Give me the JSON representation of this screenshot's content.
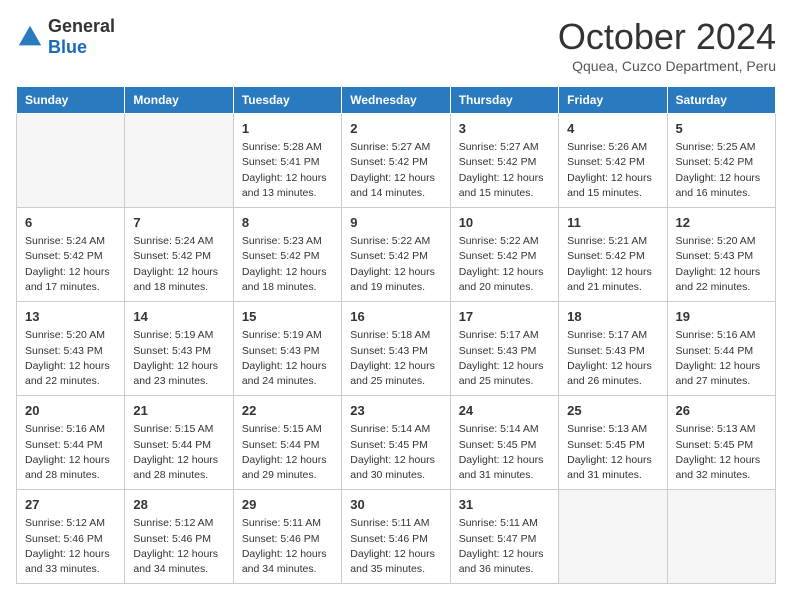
{
  "logo": {
    "general": "General",
    "blue": "Blue"
  },
  "title": "October 2024",
  "subtitle": "Qquea, Cuzco Department, Peru",
  "days_of_week": [
    "Sunday",
    "Monday",
    "Tuesday",
    "Wednesday",
    "Thursday",
    "Friday",
    "Saturday"
  ],
  "weeks": [
    [
      {
        "day": "",
        "sunrise": "",
        "sunset": "",
        "daylight": ""
      },
      {
        "day": "",
        "sunrise": "",
        "sunset": "",
        "daylight": ""
      },
      {
        "day": "1",
        "sunrise": "Sunrise: 5:28 AM",
        "sunset": "Sunset: 5:41 PM",
        "daylight": "Daylight: 12 hours and 13 minutes."
      },
      {
        "day": "2",
        "sunrise": "Sunrise: 5:27 AM",
        "sunset": "Sunset: 5:42 PM",
        "daylight": "Daylight: 12 hours and 14 minutes."
      },
      {
        "day": "3",
        "sunrise": "Sunrise: 5:27 AM",
        "sunset": "Sunset: 5:42 PM",
        "daylight": "Daylight: 12 hours and 15 minutes."
      },
      {
        "day": "4",
        "sunrise": "Sunrise: 5:26 AM",
        "sunset": "Sunset: 5:42 PM",
        "daylight": "Daylight: 12 hours and 15 minutes."
      },
      {
        "day": "5",
        "sunrise": "Sunrise: 5:25 AM",
        "sunset": "Sunset: 5:42 PM",
        "daylight": "Daylight: 12 hours and 16 minutes."
      }
    ],
    [
      {
        "day": "6",
        "sunrise": "Sunrise: 5:24 AM",
        "sunset": "Sunset: 5:42 PM",
        "daylight": "Daylight: 12 hours and 17 minutes."
      },
      {
        "day": "7",
        "sunrise": "Sunrise: 5:24 AM",
        "sunset": "Sunset: 5:42 PM",
        "daylight": "Daylight: 12 hours and 18 minutes."
      },
      {
        "day": "8",
        "sunrise": "Sunrise: 5:23 AM",
        "sunset": "Sunset: 5:42 PM",
        "daylight": "Daylight: 12 hours and 18 minutes."
      },
      {
        "day": "9",
        "sunrise": "Sunrise: 5:22 AM",
        "sunset": "Sunset: 5:42 PM",
        "daylight": "Daylight: 12 hours and 19 minutes."
      },
      {
        "day": "10",
        "sunrise": "Sunrise: 5:22 AM",
        "sunset": "Sunset: 5:42 PM",
        "daylight": "Daylight: 12 hours and 20 minutes."
      },
      {
        "day": "11",
        "sunrise": "Sunrise: 5:21 AM",
        "sunset": "Sunset: 5:42 PM",
        "daylight": "Daylight: 12 hours and 21 minutes."
      },
      {
        "day": "12",
        "sunrise": "Sunrise: 5:20 AM",
        "sunset": "Sunset: 5:43 PM",
        "daylight": "Daylight: 12 hours and 22 minutes."
      }
    ],
    [
      {
        "day": "13",
        "sunrise": "Sunrise: 5:20 AM",
        "sunset": "Sunset: 5:43 PM",
        "daylight": "Daylight: 12 hours and 22 minutes."
      },
      {
        "day": "14",
        "sunrise": "Sunrise: 5:19 AM",
        "sunset": "Sunset: 5:43 PM",
        "daylight": "Daylight: 12 hours and 23 minutes."
      },
      {
        "day": "15",
        "sunrise": "Sunrise: 5:19 AM",
        "sunset": "Sunset: 5:43 PM",
        "daylight": "Daylight: 12 hours and 24 minutes."
      },
      {
        "day": "16",
        "sunrise": "Sunrise: 5:18 AM",
        "sunset": "Sunset: 5:43 PM",
        "daylight": "Daylight: 12 hours and 25 minutes."
      },
      {
        "day": "17",
        "sunrise": "Sunrise: 5:17 AM",
        "sunset": "Sunset: 5:43 PM",
        "daylight": "Daylight: 12 hours and 25 minutes."
      },
      {
        "day": "18",
        "sunrise": "Sunrise: 5:17 AM",
        "sunset": "Sunset: 5:43 PM",
        "daylight": "Daylight: 12 hours and 26 minutes."
      },
      {
        "day": "19",
        "sunrise": "Sunrise: 5:16 AM",
        "sunset": "Sunset: 5:44 PM",
        "daylight": "Daylight: 12 hours and 27 minutes."
      }
    ],
    [
      {
        "day": "20",
        "sunrise": "Sunrise: 5:16 AM",
        "sunset": "Sunset: 5:44 PM",
        "daylight": "Daylight: 12 hours and 28 minutes."
      },
      {
        "day": "21",
        "sunrise": "Sunrise: 5:15 AM",
        "sunset": "Sunset: 5:44 PM",
        "daylight": "Daylight: 12 hours and 28 minutes."
      },
      {
        "day": "22",
        "sunrise": "Sunrise: 5:15 AM",
        "sunset": "Sunset: 5:44 PM",
        "daylight": "Daylight: 12 hours and 29 minutes."
      },
      {
        "day": "23",
        "sunrise": "Sunrise: 5:14 AM",
        "sunset": "Sunset: 5:45 PM",
        "daylight": "Daylight: 12 hours and 30 minutes."
      },
      {
        "day": "24",
        "sunrise": "Sunrise: 5:14 AM",
        "sunset": "Sunset: 5:45 PM",
        "daylight": "Daylight: 12 hours and 31 minutes."
      },
      {
        "day": "25",
        "sunrise": "Sunrise: 5:13 AM",
        "sunset": "Sunset: 5:45 PM",
        "daylight": "Daylight: 12 hours and 31 minutes."
      },
      {
        "day": "26",
        "sunrise": "Sunrise: 5:13 AM",
        "sunset": "Sunset: 5:45 PM",
        "daylight": "Daylight: 12 hours and 32 minutes."
      }
    ],
    [
      {
        "day": "27",
        "sunrise": "Sunrise: 5:12 AM",
        "sunset": "Sunset: 5:46 PM",
        "daylight": "Daylight: 12 hours and 33 minutes."
      },
      {
        "day": "28",
        "sunrise": "Sunrise: 5:12 AM",
        "sunset": "Sunset: 5:46 PM",
        "daylight": "Daylight: 12 hours and 34 minutes."
      },
      {
        "day": "29",
        "sunrise": "Sunrise: 5:11 AM",
        "sunset": "Sunset: 5:46 PM",
        "daylight": "Daylight: 12 hours and 34 minutes."
      },
      {
        "day": "30",
        "sunrise": "Sunrise: 5:11 AM",
        "sunset": "Sunset: 5:46 PM",
        "daylight": "Daylight: 12 hours and 35 minutes."
      },
      {
        "day": "31",
        "sunrise": "Sunrise: 5:11 AM",
        "sunset": "Sunset: 5:47 PM",
        "daylight": "Daylight: 12 hours and 36 minutes."
      },
      {
        "day": "",
        "sunrise": "",
        "sunset": "",
        "daylight": ""
      },
      {
        "day": "",
        "sunrise": "",
        "sunset": "",
        "daylight": ""
      }
    ]
  ]
}
